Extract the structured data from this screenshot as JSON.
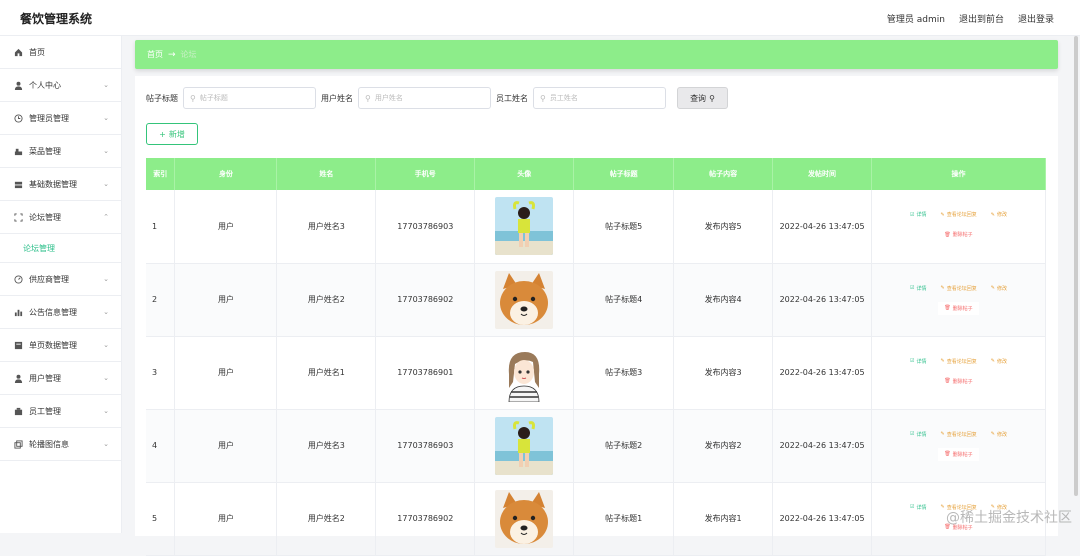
{
  "app": {
    "title": "餐饮管理系统"
  },
  "topnav": {
    "admin": "管理员 admin",
    "to_front": "退出到前台",
    "logout": "退出登录"
  },
  "sidebar": {
    "items": [
      {
        "label": "首页",
        "icon": "home-icon",
        "expandable": false
      },
      {
        "label": "个人中心",
        "icon": "user-icon",
        "expandable": true
      },
      {
        "label": "管理员管理",
        "icon": "clock-icon",
        "expandable": true
      },
      {
        "label": "菜品管理",
        "icon": "dish-icon",
        "expandable": true
      },
      {
        "label": "基础数据管理",
        "icon": "database-icon",
        "expandable": true
      },
      {
        "label": "论坛管理",
        "icon": "forum-icon",
        "expandable": true,
        "open": true
      },
      {
        "label": "供应商管理",
        "icon": "gauge-icon",
        "expandable": true
      },
      {
        "label": "公告信息管理",
        "icon": "bar-chart-icon",
        "expandable": true
      },
      {
        "label": "单页数据管理",
        "icon": "page-icon",
        "expandable": true
      },
      {
        "label": "用户管理",
        "icon": "user-icon",
        "expandable": true
      },
      {
        "label": "员工管理",
        "icon": "staff-icon",
        "expandable": true
      },
      {
        "label": "轮播图信息",
        "icon": "gallery-icon",
        "expandable": true
      }
    ],
    "submenu": {
      "label": "论坛管理"
    }
  },
  "breadcrumb": {
    "home": "首页",
    "current": "论坛"
  },
  "search": {
    "title_label": "帖子标题",
    "title_placeholder": "帖子标题",
    "username_label": "用户姓名",
    "username_placeholder": "用户姓名",
    "staff_label": "员工姓名",
    "staff_placeholder": "员工姓名",
    "button": "查询"
  },
  "add_button": "新增",
  "table": {
    "columns": [
      "索引",
      "身份",
      "姓名",
      "手机号",
      "头像",
      "帖子标题",
      "帖子内容",
      "发帖时间",
      "操作"
    ],
    "rows": [
      {
        "index": "1",
        "role": "用户",
        "name": "用户姓名3",
        "phone": "17703786903",
        "avatar": "girl-photo",
        "title": "帖子标题5",
        "content": "发布内容5",
        "time": "2022-04-26 13:47:05"
      },
      {
        "index": "2",
        "role": "用户",
        "name": "用户姓名2",
        "phone": "17703786902",
        "avatar": "shiba-dog",
        "title": "帖子标题4",
        "content": "发布内容4",
        "time": "2022-04-26 13:47:05"
      },
      {
        "index": "3",
        "role": "用户",
        "name": "用户姓名1",
        "phone": "17703786901",
        "avatar": "cartoon-girl",
        "title": "帖子标题3",
        "content": "发布内容3",
        "time": "2022-04-26 13:47:05"
      },
      {
        "index": "4",
        "role": "用户",
        "name": "用户姓名3",
        "phone": "17703786903",
        "avatar": "girl-photo",
        "title": "帖子标题2",
        "content": "发布内容2",
        "time": "2022-04-26 13:47:05"
      },
      {
        "index": "5",
        "role": "用户",
        "name": "用户姓名2",
        "phone": "17703786902",
        "avatar": "shiba-dog",
        "title": "帖子标题1",
        "content": "发布内容1",
        "time": "2022-04-26 13:47:05"
      }
    ],
    "ops": {
      "detail": "详情",
      "reply": "查看论坛回复",
      "edit": "修改",
      "delete": "删除帖子"
    }
  },
  "watermark": "@稀土掘金技术社区",
  "colors": {
    "accent": "#8ded8a",
    "link_green": "#2bbf8a",
    "warning": "#e6a23c",
    "danger": "#f56c6c"
  }
}
